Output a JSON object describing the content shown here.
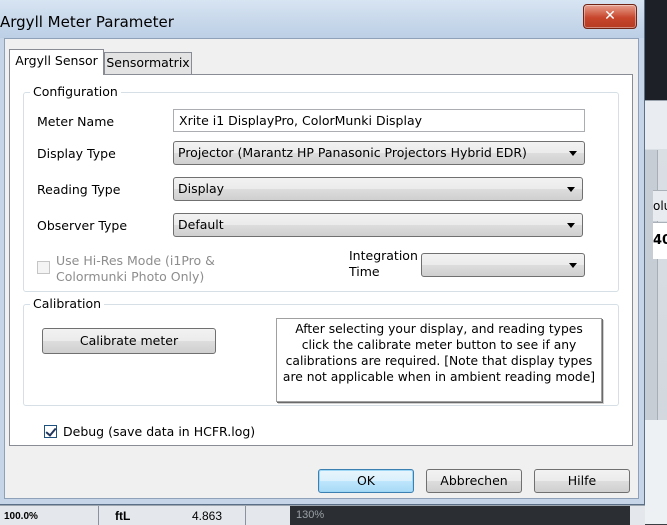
{
  "window": {
    "title": "Argyll Meter Parameter",
    "close_label": "✕"
  },
  "tabs": [
    {
      "label": "Argyll Sensor",
      "active": true
    },
    {
      "label": "Sensormatrix",
      "active": false
    }
  ],
  "configuration": {
    "group_label": "Configuration",
    "meter_name_label": "Meter Name",
    "meter_name_value": "Xrite i1 DisplayPro, ColorMunki Display",
    "display_type_label": "Display Type",
    "display_type_value": "Projector (Marantz HP Panasonic Projectors Hybrid EDR)",
    "reading_type_label": "Reading Type",
    "reading_type_value": "Display",
    "observer_type_label": "Observer Type",
    "observer_type_value": "Default",
    "hires_label": "Use Hi-Res Mode (i1Pro & Colormunki Photo Only)",
    "hires_checked": false,
    "hires_enabled": false,
    "integration_time_label": "Integration Time",
    "integration_time_value": ""
  },
  "calibration": {
    "group_label": "Calibration",
    "button_label": "Calibrate meter",
    "info_text": "After selecting your display, and reading types click the calibrate meter button to see if any calibrations are required. [Note that display types are not applicable when in ambient reading mode]"
  },
  "debug": {
    "label": "Debug (save data in HCFR.log)",
    "checked": true
  },
  "footer": {
    "ok_label": "OK",
    "cancel_label": "Abbrechen",
    "help_label": "Hilfe"
  },
  "background": {
    "right_cell_text": "olu",
    "right_cell_value": "40",
    "bottom_percent": "100.0%",
    "bottom_unit": "ftL",
    "bottom_value": "4.863",
    "bottom_zoom": "130%"
  },
  "colors": {
    "title_bar": "#bccfe5",
    "close_button": "#c7462c",
    "default_button": "#3c7fb1"
  }
}
